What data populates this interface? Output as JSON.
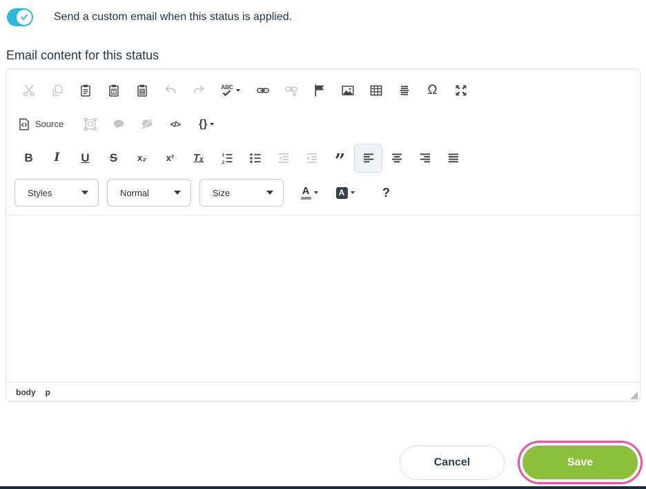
{
  "page": {
    "toggle_label": "Send a custom email when this status is applied.",
    "section_label": "Email content for this status"
  },
  "toolbar": {
    "source_label": "Source",
    "styles_dropdown": "Styles",
    "format_dropdown": "Normal",
    "size_dropdown": "Size"
  },
  "glyphs": {
    "bold": "B",
    "italic": "I",
    "underline": "U",
    "strikethrough": "S",
    "subscript": "x₂",
    "superscript": "x²",
    "remove_format": "Tₓ",
    "blockquote": "”",
    "special_char": "Ω",
    "code": "</>",
    "merge_tags": "{}",
    "spellcheck": "ABC",
    "text_color": "A",
    "bg_color": "A",
    "about": "?"
  },
  "statusbar": {
    "elements": [
      "body",
      "p"
    ]
  },
  "footer": {
    "cancel_label": "Cancel",
    "save_label": "Save"
  },
  "colors": {
    "toggle_on": "#2bb8d9",
    "save_green": "#8cc03c",
    "annotation_pink": "#f2529d",
    "bottom_bar": "#1d2d35",
    "heading_text": "#233748",
    "icon_enabled": "#474747",
    "icon_disabled": "#c8c8c8"
  }
}
